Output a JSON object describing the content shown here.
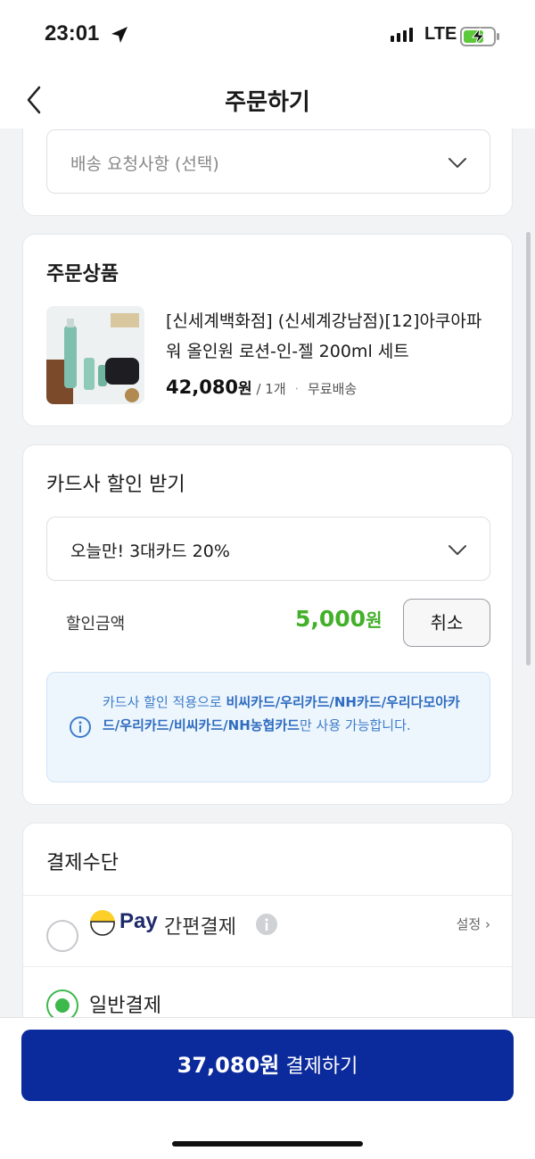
{
  "status_bar": {
    "time": "23:01",
    "network": "LTE"
  },
  "header": {
    "title": "주문하기"
  },
  "delivery": {
    "request_placeholder": "배송 요청사항 (선택)"
  },
  "order_items": {
    "title": "주문상품",
    "product": {
      "name": "[신세계백화점] (신세계강남점)[12]아쿠아파워 올인원 로션-인-젤 200ml 세트",
      "price": "42,080",
      "won": "원",
      "quantity": "/ 1개",
      "shipping": "무료배송"
    }
  },
  "card_discount": {
    "title": "카드사 할인 받기",
    "selected_option": "오늘만! 3대카드 20%",
    "discount_label": "할인금액",
    "discount_amount": "5,000",
    "won": "원",
    "cancel_label": "취소",
    "notice_prefix": "카드사 할인 적용으로 ",
    "notice_cards": "비씨카드/우리카드/NH카드/우리다모아카드/우리카드/비씨카드/NH농협카드",
    "notice_suffix": "만 사용 가능합니다."
  },
  "payment": {
    "title": "결제수단",
    "easy_pay": {
      "brand": "Pay",
      "label": "간편결제",
      "setup_label": "설정",
      "selected": false
    },
    "general": {
      "label": "일반결제",
      "selected": true
    }
  },
  "checkout": {
    "amount": "37,080원",
    "label": "결제하기",
    "accent_color": "#0b2a9c"
  },
  "colors": {
    "discount_green": "#43b02a",
    "radio_green": "#3cb84c",
    "notice_blue": "#3d7cc9"
  }
}
